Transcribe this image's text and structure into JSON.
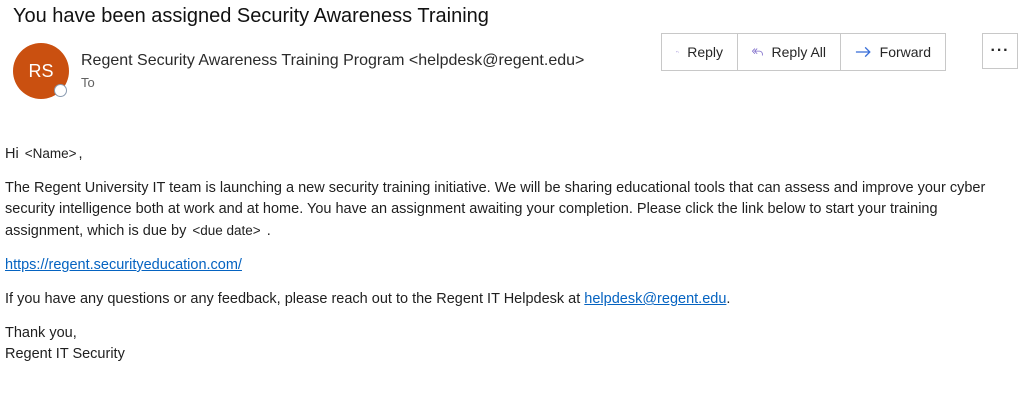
{
  "email": {
    "subject": "You have been assigned Security Awareness Training",
    "sender": {
      "initials": "RS",
      "display": "Regent Security Awareness Training Program <helpdesk@regent.edu>",
      "avatar_color": "#ca5010"
    },
    "to_label": "To",
    "actions": {
      "reply": "Reply",
      "reply_all": "Reply All",
      "forward": "Forward",
      "more": "···"
    },
    "body": {
      "greeting_prefix": "Hi",
      "name_placeholder": "<Name>",
      "greeting_suffix": ",",
      "main_text": "The Regent University IT team is launching a new security training initiative. We will be sharing educational tools that can assess and improve your cyber security intelligence both at work and at home. You have an assignment awaiting your completion. Please click the link below to start your training assignment, which is due by",
      "due_date_placeholder": "<due date>",
      "main_suffix": ".",
      "training_link": "https://regent.securityeducation.com/",
      "questions_text": "If you have any questions or any feedback, please reach out to the Regent IT Helpdesk at",
      "helpdesk_link": "helpdesk@regent.edu",
      "questions_suffix": ".",
      "closing": "Thank you,",
      "signature": "Regent IT Security"
    }
  },
  "colors": {
    "link": "#0563c1",
    "icon_accent": "#3a6fd8",
    "reply_all_accent": "#7b68c8"
  },
  "icons": [
    "reply-icon",
    "reply-all-icon",
    "forward-icon",
    "more-icon",
    "presence-icon"
  ]
}
